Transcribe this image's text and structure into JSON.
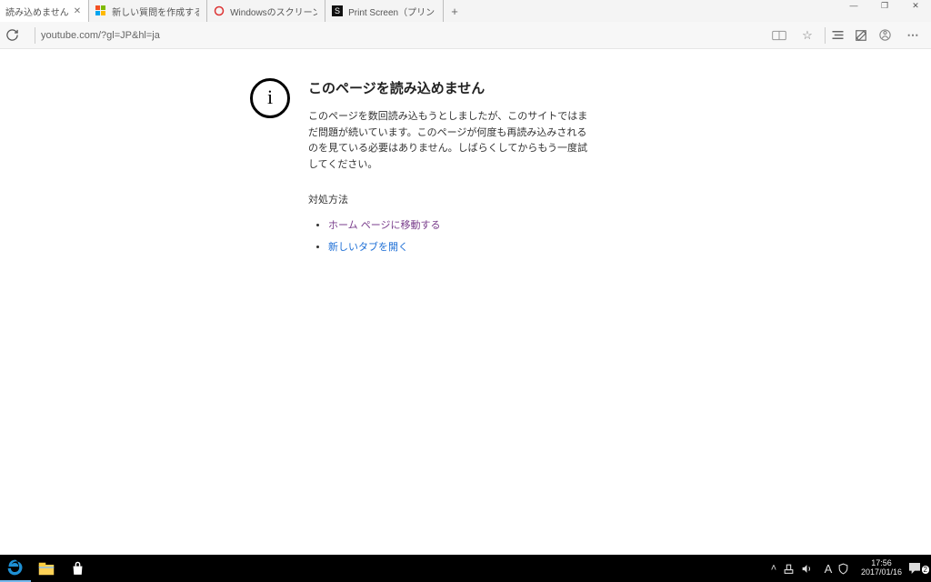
{
  "window_controls": {
    "minimize": "—",
    "maximize": "❐",
    "close": "✕"
  },
  "tabs": [
    {
      "title": "読み込めません",
      "active": true,
      "favicon": "blank",
      "has_close": true
    },
    {
      "title": "新しい質問を作成する、または！",
      "active": false,
      "favicon": "ms"
    },
    {
      "title": "Windowsのスクリーンショットの",
      "active": false,
      "favicon": "ring"
    },
    {
      "title": "Print Screen（プリントスクリー",
      "active": false,
      "favicon": "s"
    }
  ],
  "newtab_label": "+",
  "addressbar": {
    "refresh_glyph": "↻",
    "url": "youtube.com/?gl=JP&hl=ja",
    "icons": {
      "reading": "▭",
      "star": "☆",
      "hub": "≡",
      "note": "✎",
      "share": "⟁",
      "more": "⋯"
    }
  },
  "error_page": {
    "info_glyph": "i",
    "title": "このページを読み込めません",
    "description": "このページを数回読み込もうとしましたが、このサイトではまだ問題が続いています。このページが何度も再読み込みされるのを見ている必要はありません。しばらくしてからもう一度試してください。",
    "subheading": "対処方法",
    "links": [
      {
        "text": "ホーム ページに移動する",
        "state": "visited"
      },
      {
        "text": "新しいタブを開く",
        "state": "normal"
      }
    ]
  },
  "taskbar": {
    "tray_chevron": "˄",
    "ime_label": "A",
    "clock_time": "17:56",
    "clock_date": "2017/01/16",
    "notification_count": "2"
  }
}
